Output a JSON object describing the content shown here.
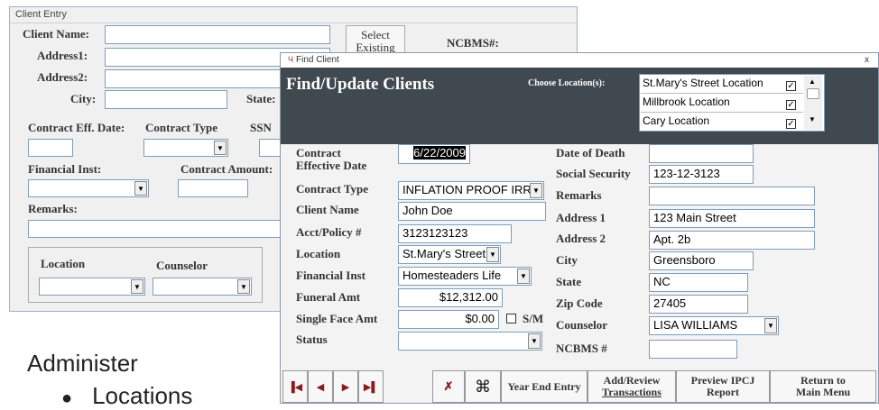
{
  "back_window": {
    "title": "Client Entry",
    "client_name_label": "Client Name:",
    "address1_label": "Address1:",
    "address2_label": "Address2:",
    "city_label": "City:",
    "state_label": "State:",
    "select_existing_label": "Select Existing",
    "ncbms_label": "NCBMS#:",
    "contract_eff_date_label": "Contract Eff. Date:",
    "contract_type_label": "Contract Type",
    "ssn_label": "SSN",
    "financial_inst_label": "Financial Inst:",
    "contract_amount_label": "Contract Amount:",
    "remarks_label": "Remarks:",
    "location_label": "Location",
    "counselor_label": "Counselor"
  },
  "front_window": {
    "title": "Find Client",
    "close_label": "x",
    "heading": "Find/Update Clients",
    "choose_location_label": "Choose Location(s):",
    "locations": [
      {
        "name": "St.Mary's Street Location",
        "checked": true
      },
      {
        "name": "Millbrook Location",
        "checked": true
      },
      {
        "name": "Cary Location",
        "checked": true
      }
    ],
    "fields_left": {
      "contract_effective_date_label": "Contract Effective Date",
      "contract_effective_date_value": "6/22/2009",
      "contract_type_label": "Contract Type",
      "contract_type_value": "INFLATION PROOF IRRE",
      "client_name_label": "Client Name",
      "client_name_value": "John Doe",
      "acct_policy_label": "Acct/Policy #",
      "acct_policy_value": "3123123123",
      "location_label": "Location",
      "location_value": "St.Mary's Street",
      "financial_inst_label": "Financial Inst",
      "financial_inst_value": "Homesteaders Life",
      "funeral_amt_label": "Funeral Amt",
      "funeral_amt_value": "$12,312.00",
      "single_face_amt_label": "Single Face Amt",
      "single_face_amt_value": "$0.00",
      "sm_label": "S/M",
      "status_label": "Status",
      "status_value": ""
    },
    "fields_right": {
      "date_of_death_label": "Date of Death",
      "date_of_death_value": "",
      "social_security_label": "Social Security",
      "social_security_value": "123-12-3123",
      "remarks_label": "Remarks",
      "remarks_value": "",
      "address1_label": "Address 1",
      "address1_value": "123 Main Street",
      "address2_label": "Address 2",
      "address2_value": "Apt. 2b",
      "city_label": "City",
      "city_value": "Greensboro",
      "state_label": "State",
      "state_value": "NC",
      "zip_label": "Zip Code",
      "zip_value": "27405",
      "counselor_label": "Counselor",
      "counselor_value": "LISA WILLIAMS",
      "ncbms_label": "NCBMS #",
      "ncbms_value": ""
    },
    "buttons": {
      "year_end_entry": "Year End Entry",
      "add_review_line1": "Add/Review",
      "add_review_line2": "Transactions",
      "preview_line1": "Preview IPCJ",
      "preview_line2": "Report",
      "return_line1": "Return to",
      "return_line2": "Main Menu"
    },
    "nav_icons": [
      "first-record-icon",
      "previous-record-icon",
      "next-record-icon",
      "last-record-icon",
      "delete-record-icon",
      "binoculars-icon"
    ]
  },
  "slide_text": {
    "heading": "Administer",
    "bullet": "Locations"
  },
  "colors": {
    "header_bg": "#404850",
    "label_text": "#333333",
    "nav_arrow": "#8b1a1a"
  }
}
